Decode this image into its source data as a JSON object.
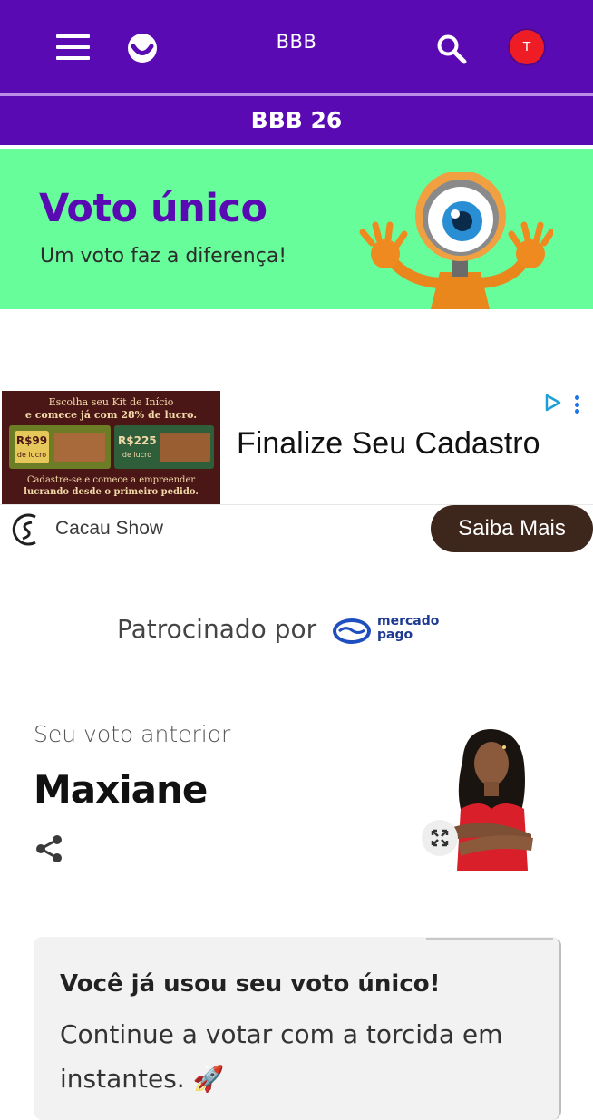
{
  "header": {
    "brand_title": "BBB",
    "avatar_initial": "T",
    "section_title": "BBB 26",
    "colors": {
      "primary": "#5a0ab3",
      "avatar": "#ee1c24"
    }
  },
  "banner": {
    "title": "Voto único",
    "subtitle": "Um voto faz a diferença!",
    "background": "#67fd9b"
  },
  "ad": {
    "image_text": {
      "line1": "Escolha seu Kit de Início",
      "line2": "e comece já com 28% de lucro.",
      "kit1_value": "R$99",
      "kit1_label": "de lucro",
      "kit2_value": "R$225",
      "kit2_label": "de lucro",
      "footer1": "Cadastre-se e comece a empreender",
      "footer2": "lucrando desde o primeiro pedido."
    },
    "headline": "Finalize Seu Cadastro",
    "advertiser": "Cacau Show",
    "cta_label": "Saiba Mais"
  },
  "sponsor": {
    "label": "Patrocinado por",
    "logo_line1": "mercado",
    "logo_line2": "pago"
  },
  "previous_vote": {
    "label": "Seu voto anterior",
    "name": "Maxiane"
  },
  "info_card": {
    "title": "Você já usou seu voto único!",
    "body": "Continue a votar com a torcida em instantes. 🚀"
  }
}
